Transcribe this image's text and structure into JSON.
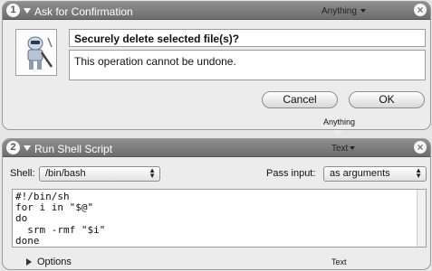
{
  "action1": {
    "number": "1",
    "title": "Ask for Confirmation",
    "input_type": "Anything",
    "close": "×",
    "message": "Securely delete selected file(s)?",
    "detail": "This operation cannot be undone.",
    "cancel_label": "Cancel",
    "ok_label": "OK",
    "output_type": "Anything",
    "icon": "automator-robot-icon"
  },
  "action2": {
    "number": "2",
    "title": "Run Shell Script",
    "input_type": "Text",
    "close": "×",
    "shell_label": "Shell:",
    "shell_value": "/bin/bash",
    "pass_input_label": "Pass input:",
    "pass_input_value": "as arguments",
    "script": "#!/bin/sh\nfor i in \"$@\"\ndo\n  srm -rmf \"$i\"\ndone",
    "options_label": "Options",
    "output_type": "Text"
  }
}
